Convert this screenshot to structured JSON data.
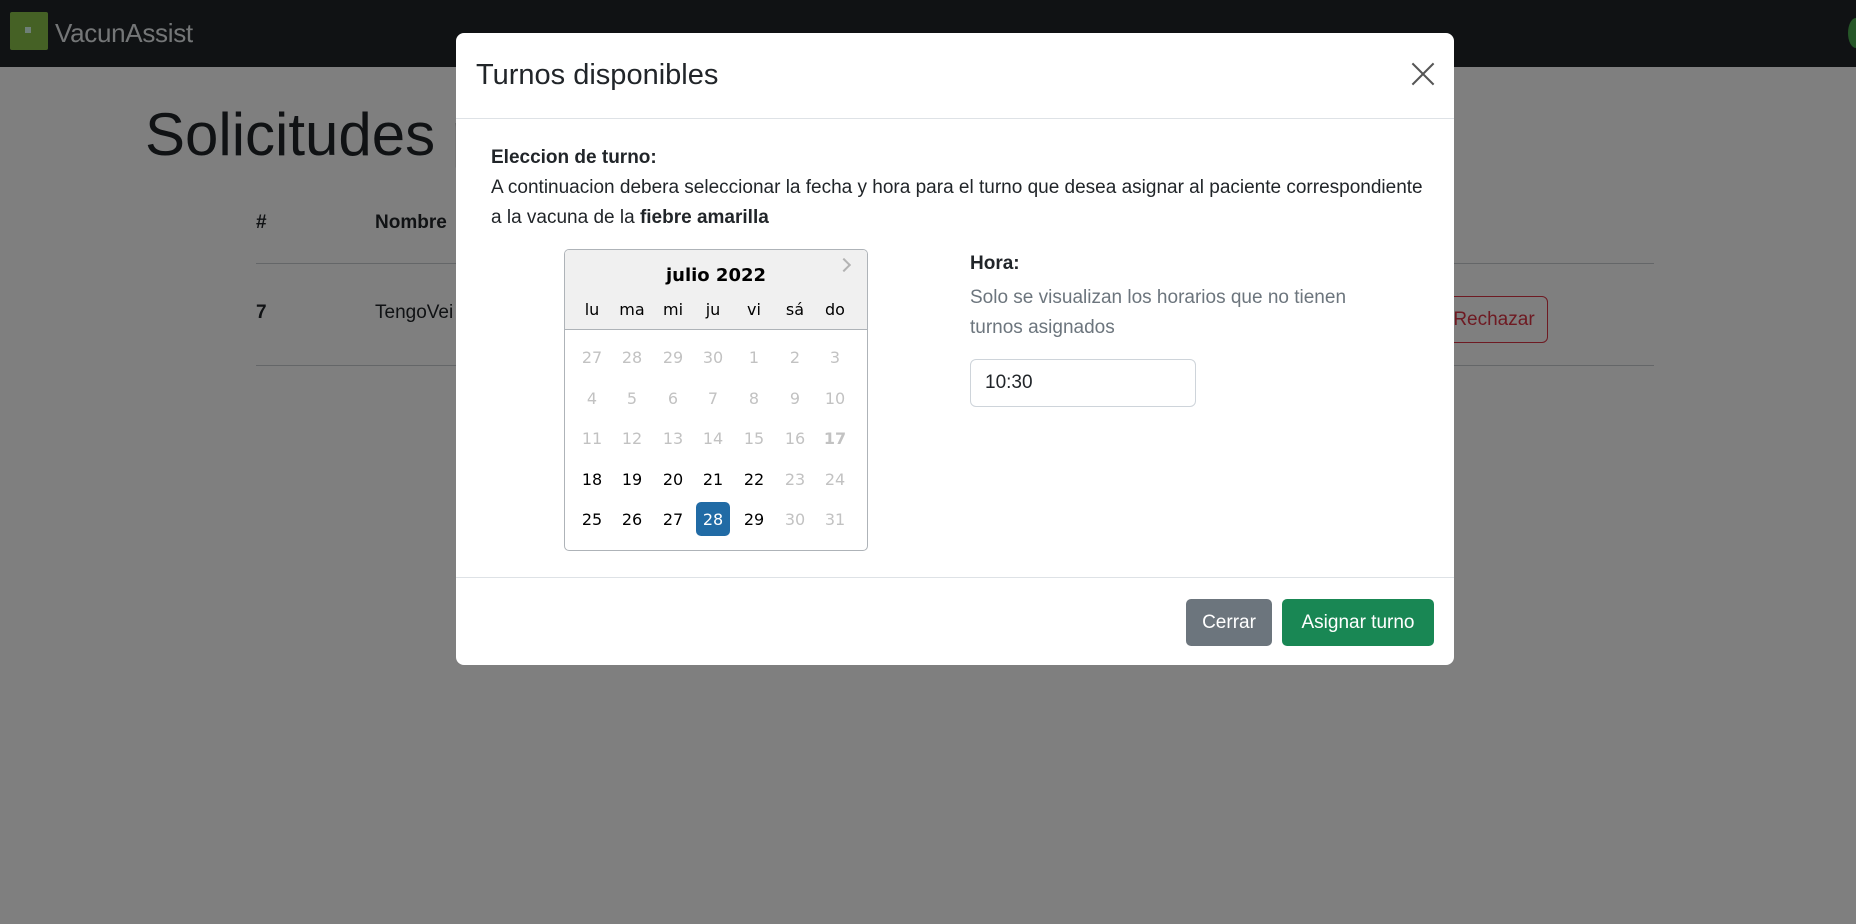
{
  "navbar": {
    "brand": "VacunAssist"
  },
  "page": {
    "title": "Solicitudes p",
    "table": {
      "headers": [
        "#",
        "Nombre"
      ],
      "rows": [
        {
          "id": "7",
          "name": "TengoVei",
          "reject_label": "Rechazar"
        }
      ]
    }
  },
  "modal": {
    "title": "Turnos disponibles",
    "section_title": "Eleccion de turno:",
    "intro_text": "A continuacion debera seleccionar la fecha y hora para el turno que desea asignar al paciente correspondiente a la vacuna de la ",
    "intro_bold": "fiebre amarilla",
    "calendar": {
      "month_label": "julio 2022",
      "weekdays": [
        "lu",
        "ma",
        "mi",
        "ju",
        "vi",
        "sá",
        "do"
      ],
      "weeks": [
        [
          "27",
          "28",
          "29",
          "30",
          "1",
          "2",
          "3"
        ],
        [
          "4",
          "5",
          "6",
          "7",
          "8",
          "9",
          "10"
        ],
        [
          "11",
          "12",
          "13",
          "14",
          "15",
          "16",
          "17"
        ],
        [
          "18",
          "19",
          "20",
          "21",
          "22",
          "23",
          "24"
        ],
        [
          "25",
          "26",
          "27",
          "28",
          "29",
          "30",
          "31"
        ]
      ],
      "selected_day": "28",
      "enabled_days": [
        "18",
        "19",
        "20",
        "21",
        "22",
        "25",
        "26",
        "27",
        "28",
        "29"
      ],
      "today": "17"
    },
    "hora_label": "Hora:",
    "hora_help": "Solo se visualizan los horarios que no tienen turnos asignados",
    "hora_value": "10:30",
    "close_label": "Cerrar",
    "assign_label": "Asignar turno"
  }
}
